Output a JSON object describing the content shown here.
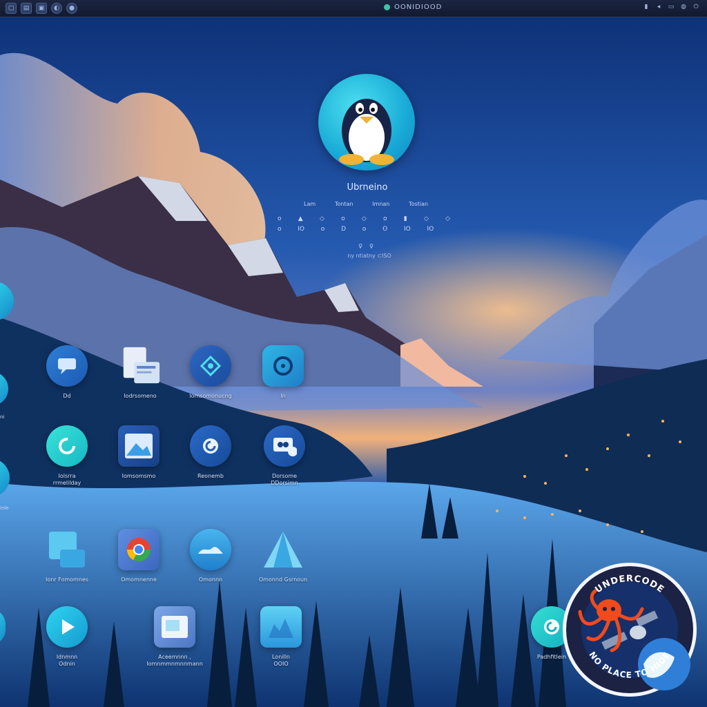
{
  "top_panel": {
    "status_text": "OONIDIOOD",
    "left_icons": [
      "window-icon",
      "file-icon",
      "folder-icon",
      "browser-icon",
      "settings-icon"
    ],
    "right_icons": [
      "network-icon",
      "volume-icon",
      "battery-icon",
      "user-icon",
      "power-icon"
    ]
  },
  "profile": {
    "username": "Ubrneino",
    "meta": [
      "Lam",
      "Tontan",
      "Imnan",
      "Tostian"
    ],
    "stats_row1": [
      "o",
      "▲",
      "◇",
      "o",
      "◇",
      "o",
      "▮",
      "◇",
      "◇"
    ],
    "stats_row2": [
      "o",
      "IO",
      "o",
      "D",
      "o",
      "O",
      "IO",
      "IO",
      ""
    ],
    "small_icons": [
      "♀",
      "♀"
    ],
    "caption": "ny ntiatny ⊂ISO"
  },
  "apps": [
    {
      "label": "Dd"
    },
    {
      "label": "Iodrsomeno"
    },
    {
      "label": "Iomsomonucng"
    },
    {
      "label": "In"
    },
    {
      "label": "Iolsrra\nrrmelilday"
    },
    {
      "label": "Iomsomsmo"
    },
    {
      "label": "Reonemb"
    },
    {
      "label": "Dorsome\nDDorsimn"
    },
    {
      "label": "Ionr Fomomnes"
    },
    {
      "label": "Omomnenne"
    },
    {
      "label": "Omonnn"
    },
    {
      "label": "Omonnd Gsrnoun"
    },
    {
      "label": "Idnmnn\nOdnin"
    },
    {
      "label": "Aceemnnn ,\nIomnmmnmnnmann"
    },
    {
      "label": "Lonilln\nOOIO"
    },
    {
      "label": "Padhfitlein"
    }
  ],
  "edge_labels": [
    "ni",
    "inle"
  ],
  "badge": {
    "top_text": "UNDERCODE",
    "bottom_text": "NO PLACE TO HIDE"
  },
  "colors": {
    "accent": "#1fc9e0",
    "panel_bg": "#161f38",
    "badge_ring": "#1b2244",
    "octopus": "#f04b1c"
  }
}
